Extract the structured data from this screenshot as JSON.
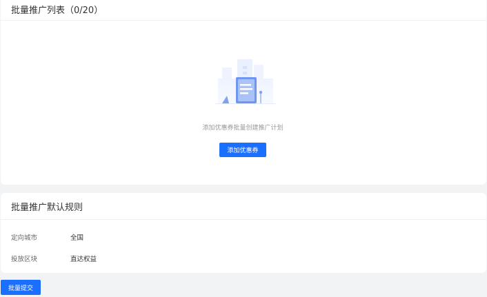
{
  "list_card": {
    "title": "批量推广列表（0/20）",
    "empty_text": "添加优惠券批量创建推广计划",
    "add_button_label": "添加优惠券"
  },
  "rules_card": {
    "title": "批量推广默认规则",
    "rows": [
      {
        "label": "定向城市",
        "value": "全国"
      },
      {
        "label": "投放区块",
        "value": "直达权益"
      }
    ]
  },
  "submit_button_label": "批量提交",
  "colors": {
    "accent": "#1b6fff",
    "background": "#f2f3f5"
  },
  "icons": {
    "empty": "empty-document-illustration"
  }
}
